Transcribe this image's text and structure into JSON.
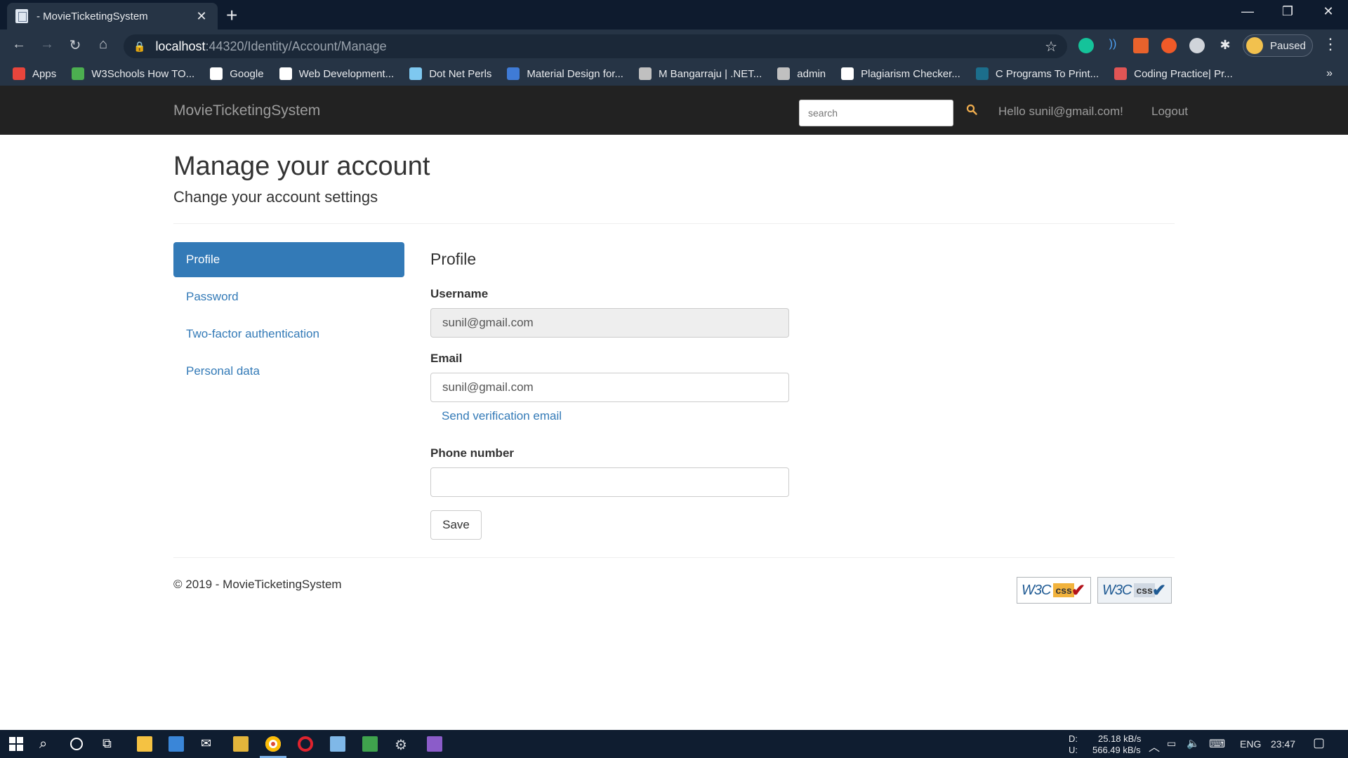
{
  "browser": {
    "tab_title": "- MovieTicketingSystem",
    "url_host": "localhost",
    "url_path": ":44320/Identity/Account/Manage",
    "profile_label": "Paused",
    "bookmarks": [
      {
        "label": "Apps",
        "color": "#e8453c"
      },
      {
        "label": "W3Schools How TO...",
        "color": "#4caf50"
      },
      {
        "label": "Google",
        "color": "#ffffff"
      },
      {
        "label": "Web Development...",
        "color": "#ffffff"
      },
      {
        "label": "Dot Net Perls",
        "color": "#7ec8f0"
      },
      {
        "label": "Material Design for...",
        "color": "#3f7bd6"
      },
      {
        "label": "M Bangarraju | .NET...",
        "color": "#c0c0c0"
      },
      {
        "label": "admin",
        "color": "#c0c0c0"
      },
      {
        "label": "Plagiarism Checker...",
        "color": "#ffffff"
      },
      {
        "label": "C Programs To Print...",
        "color": "#1c6e8c"
      },
      {
        "label": "Coding Practice| Pr...",
        "color": "#e05555"
      }
    ]
  },
  "site": {
    "brand": "MovieTicketingSystem",
    "search_placeholder": "search",
    "hello": "Hello sunil@gmail.com!",
    "logout": "Logout",
    "accent": "#337ab7",
    "search_icon_color": "#f0ad4e"
  },
  "page": {
    "title": "Manage your account",
    "subtitle": "Change your account settings",
    "sidenav": [
      "Profile",
      "Password",
      "Two-factor authentication",
      "Personal data"
    ],
    "form": {
      "heading": "Profile",
      "username_label": "Username",
      "username_value": "sunil@gmail.com",
      "email_label": "Email",
      "email_value": "sunil@gmail.com",
      "verify_link": "Send verification email",
      "phone_label": "Phone number",
      "phone_value": "",
      "save_label": "Save"
    }
  },
  "footer": {
    "copyright": "© 2019 - MovieTicketingSystem",
    "badge_w3c": "W3C",
    "badge_css": "css"
  },
  "taskbar": {
    "net_d_label": "D:",
    "net_u_label": "U:",
    "net_down": "25.18 kB/s",
    "net_up": "566.49 kB/s",
    "lang": "ENG",
    "time": "23:47"
  }
}
